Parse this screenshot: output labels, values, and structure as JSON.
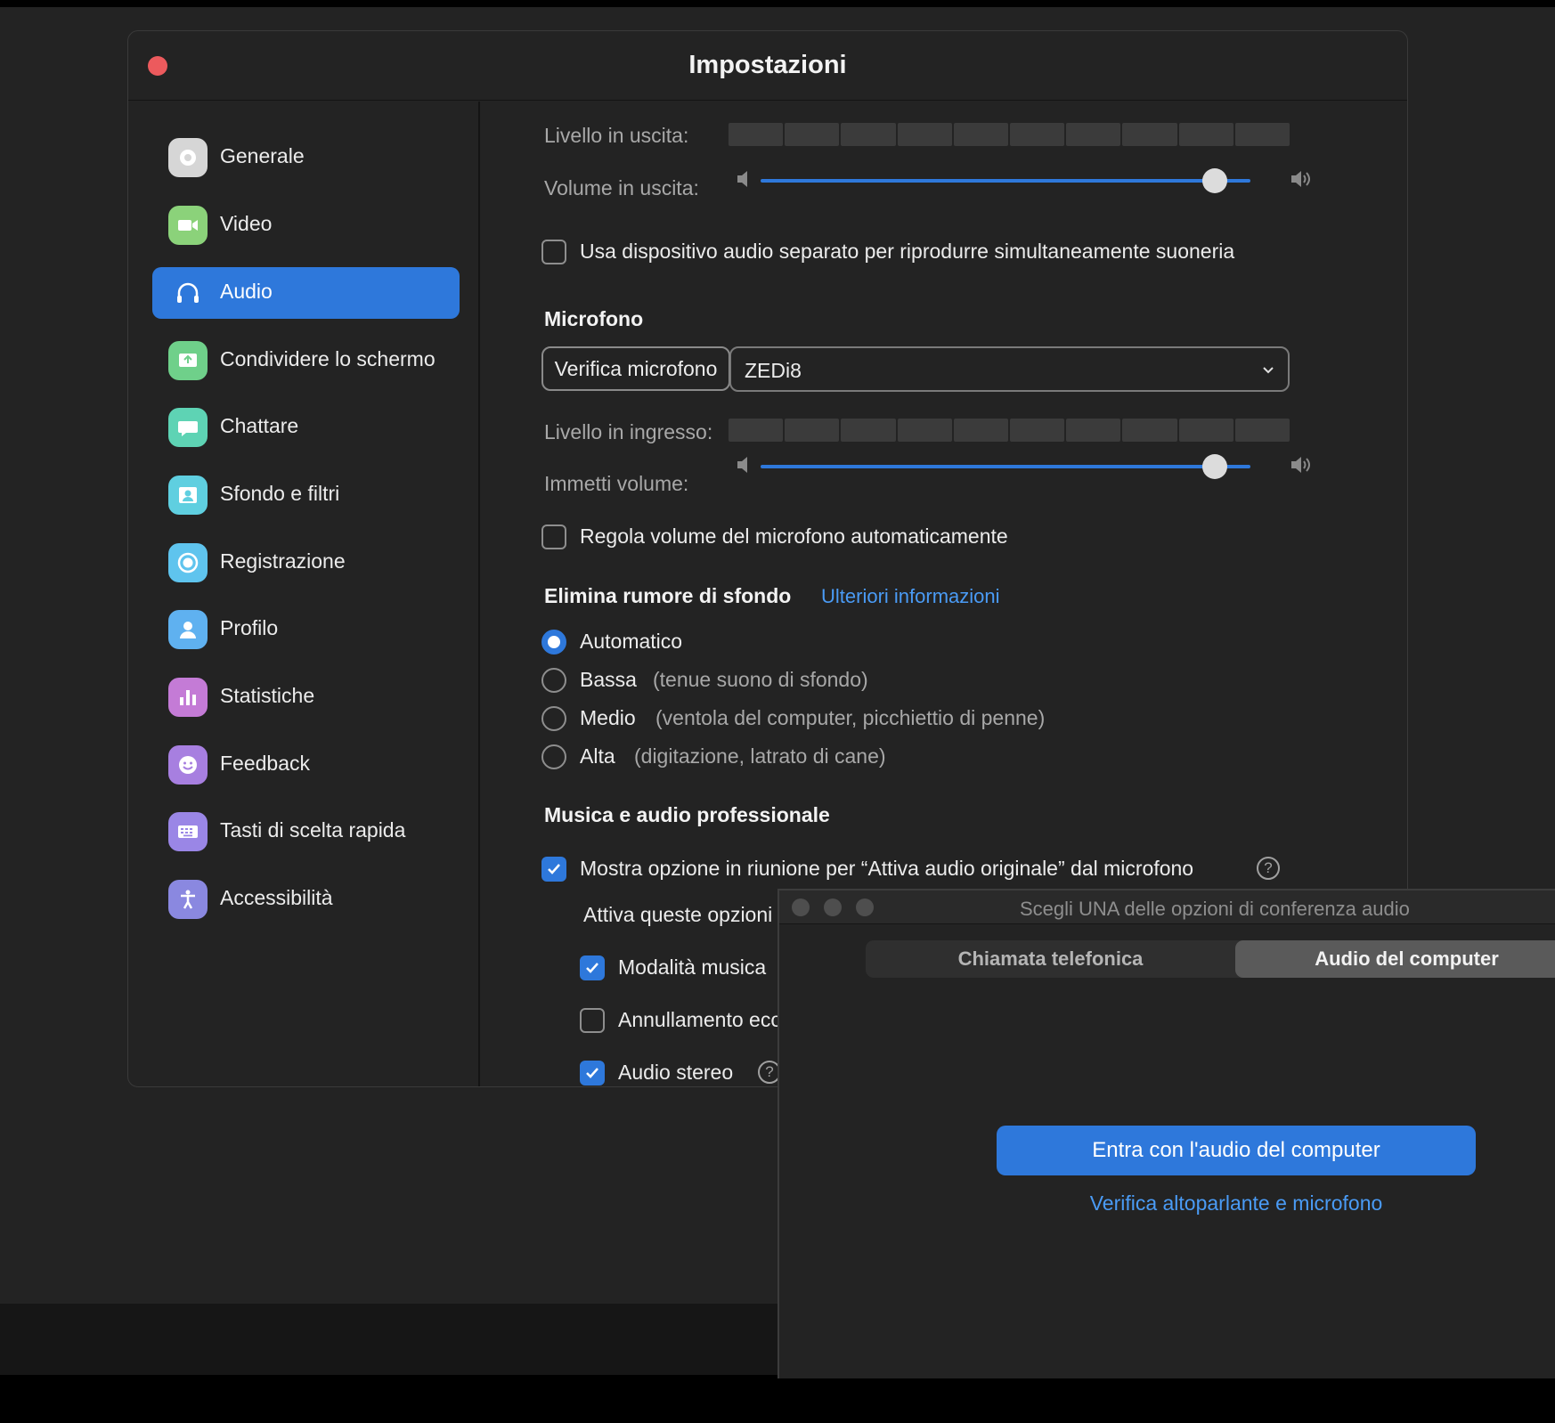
{
  "window": {
    "title": "Impostazioni"
  },
  "sidebar": {
    "items": [
      {
        "label": "Generale",
        "icon": "gear-icon",
        "color": "#d6d6d6",
        "active": false
      },
      {
        "label": "Video",
        "icon": "video-camera-icon",
        "color": "#8bd27a",
        "active": false
      },
      {
        "label": "Audio",
        "icon": "headphones-icon",
        "color": "#2e78db",
        "active": true
      },
      {
        "label": "Condividere lo schermo",
        "icon": "share-screen-icon",
        "color": "#6fd08a",
        "active": false
      },
      {
        "label": "Chattare",
        "icon": "chat-bubble-icon",
        "color": "#5ed3b4",
        "active": false
      },
      {
        "label": "Sfondo e filtri",
        "icon": "background-person-icon",
        "color": "#5fcfe0",
        "active": false
      },
      {
        "label": "Registrazione",
        "icon": "record-icon",
        "color": "#5fc4ee",
        "active": false
      },
      {
        "label": "Profilo",
        "icon": "profile-icon",
        "color": "#5fb1f0",
        "active": false
      },
      {
        "label": "Statistiche",
        "icon": "bar-chart-icon",
        "color": "#c47bd6",
        "active": false
      },
      {
        "label": "Feedback",
        "icon": "smiley-icon",
        "color": "#a77fe0",
        "active": false
      },
      {
        "label": "Tasti di scelta rapida",
        "icon": "keyboard-icon",
        "color": "#9a86e6",
        "active": false
      },
      {
        "label": "Accessibilità",
        "icon": "accessibility-icon",
        "color": "#8a88e0",
        "active": false
      }
    ]
  },
  "speaker": {
    "output_level_label": "Livello in uscita:",
    "output_volume_label": "Volume in uscita:",
    "output_volume": 0.95,
    "separate_device_label": "Usa dispositivo audio separato per riprodurre simultaneamente suoneria",
    "separate_device_checked": false
  },
  "microphone": {
    "section_title": "Microfono",
    "test_button": "Verifica microfono",
    "device_selected": "ZEDi8",
    "input_level_label": "Livello in ingresso:",
    "input_volume_label": "Immetti volume:",
    "input_volume": 0.95,
    "auto_adjust_label": "Regola volume del microfono automaticamente",
    "auto_adjust_checked": false
  },
  "noise": {
    "section_title": "Elimina rumore di sfondo",
    "more_info_link": "Ulteriori informazioni",
    "options": [
      {
        "label": "Automatico",
        "hint": "",
        "checked": true
      },
      {
        "label": "Bassa",
        "hint": "(tenue suono di sfondo)",
        "checked": false
      },
      {
        "label": "Medio",
        "hint": "(ventola del computer, picchiettio di penne)",
        "checked": false
      },
      {
        "label": "Alta",
        "hint": "(digitazione, latrato di cane)",
        "checked": false
      }
    ]
  },
  "music": {
    "section_title": "Musica e audio professionale",
    "original_audio_label": "Mostra opzione in riunione per “Attiva audio originale” dal microfono",
    "original_audio_checked": true,
    "sub_heading": "Attiva queste opzioni quando l’audio originale è attivo",
    "sub_options": [
      {
        "label": "Modalità musica",
        "checked": true
      },
      {
        "label": "Annullamento eco",
        "checked": false
      },
      {
        "label": "Audio stereo",
        "checked": true
      }
    ]
  },
  "dialog": {
    "title": "Scegli UNA delle opzioni di conferenza audio",
    "tabs": [
      {
        "label": "Chiamata telefonica",
        "active": false
      },
      {
        "label": "Audio del computer",
        "active": true
      }
    ],
    "join_button": "Entra con l'audio del computer",
    "test_link": "Verifica altoparlante e microfono"
  },
  "colors": {
    "accent": "#2e78db",
    "link": "#4a9bf5",
    "close": "#ec5a5d"
  }
}
